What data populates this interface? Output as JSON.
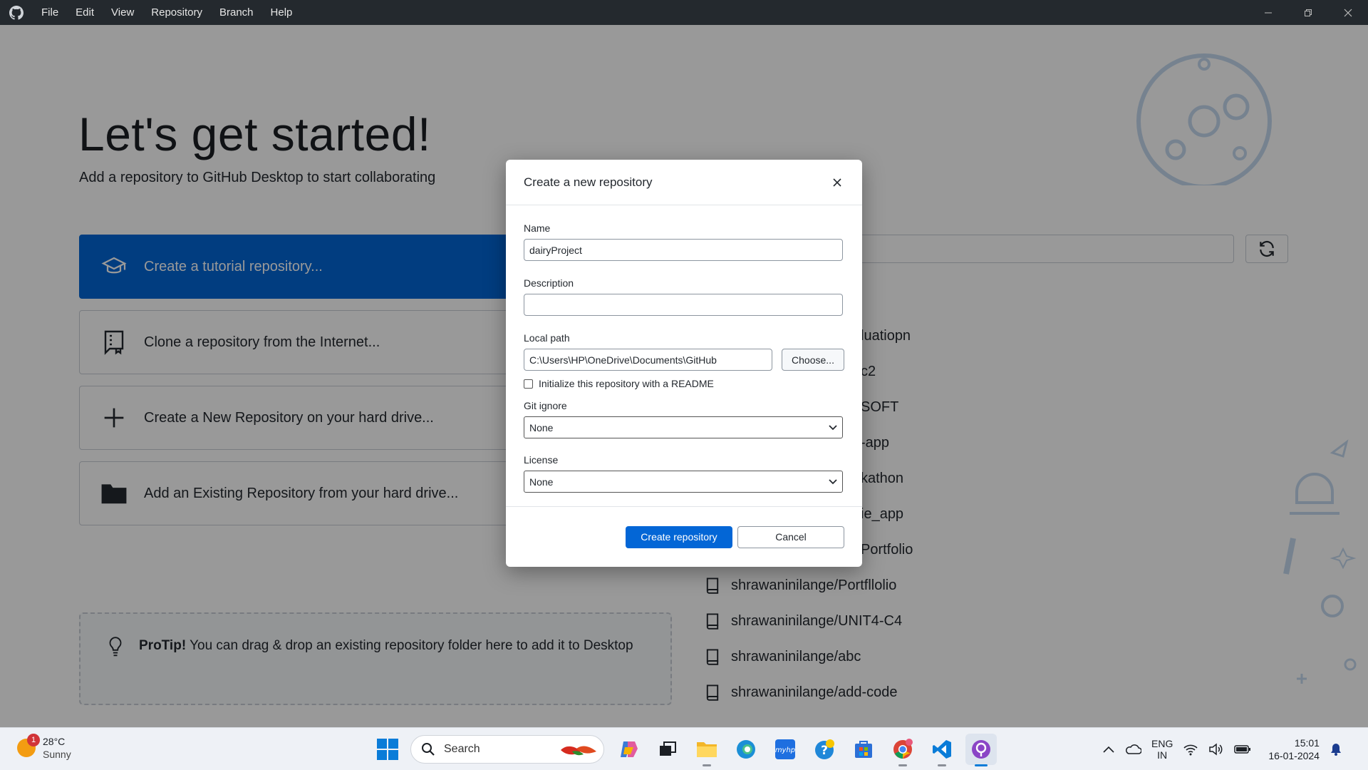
{
  "menu": [
    "File",
    "Edit",
    "View",
    "Repository",
    "Branch",
    "Help"
  ],
  "welcome": {
    "heading": "Let's get started!",
    "subheading": "Add a repository to GitHub Desktop to start collaborating",
    "actions": [
      {
        "label": "Create a tutorial repository...",
        "icon": "graduation-cap-icon"
      },
      {
        "label": "Clone a repository from the Internet...",
        "icon": "repo-clone-icon"
      },
      {
        "label": "Create a New Repository on your hard drive...",
        "icon": "plus-icon"
      },
      {
        "label": "Add an Existing Repository from your hard drive...",
        "icon": "folder-icon"
      }
    ],
    "protip_bold": "ProTip!",
    "protip_text": " You can drag & drop an existing repository folder here to add it to Desktop"
  },
  "repos": [
    "luatiopn",
    "c2",
    "SOFT",
    "-app",
    "kathon",
    "ie_app",
    "Portfolio",
    "shrawaninilange/Portfllolio",
    "shrawaninilange/UNIT4-C4",
    "shrawaninilange/abc",
    "shrawaninilange/add-code"
  ],
  "dialog": {
    "title": "Create a new repository",
    "name_label": "Name",
    "name_value": "dairyProject",
    "description_label": "Description",
    "description_value": "",
    "local_path_label": "Local path",
    "local_path_value": "C:\\Users\\HP\\OneDrive\\Documents\\GitHub",
    "choose_button": "Choose...",
    "readme_label": "Initialize this repository with a README",
    "gitignore_label": "Git ignore",
    "gitignore_value": "None",
    "license_label": "License",
    "license_value": "None",
    "create_button": "Create repository",
    "cancel_button": "Cancel"
  },
  "taskbar": {
    "weather_temp": "28°C",
    "weather_desc": "Sunny",
    "weather_badge": "1",
    "search_label": "Search",
    "lang_top": "ENG",
    "lang_bottom": "IN",
    "time": "15:01",
    "date": "16-01-2024"
  },
  "colors": {
    "accent": "#0366d6",
    "titlebar": "#24292e"
  }
}
